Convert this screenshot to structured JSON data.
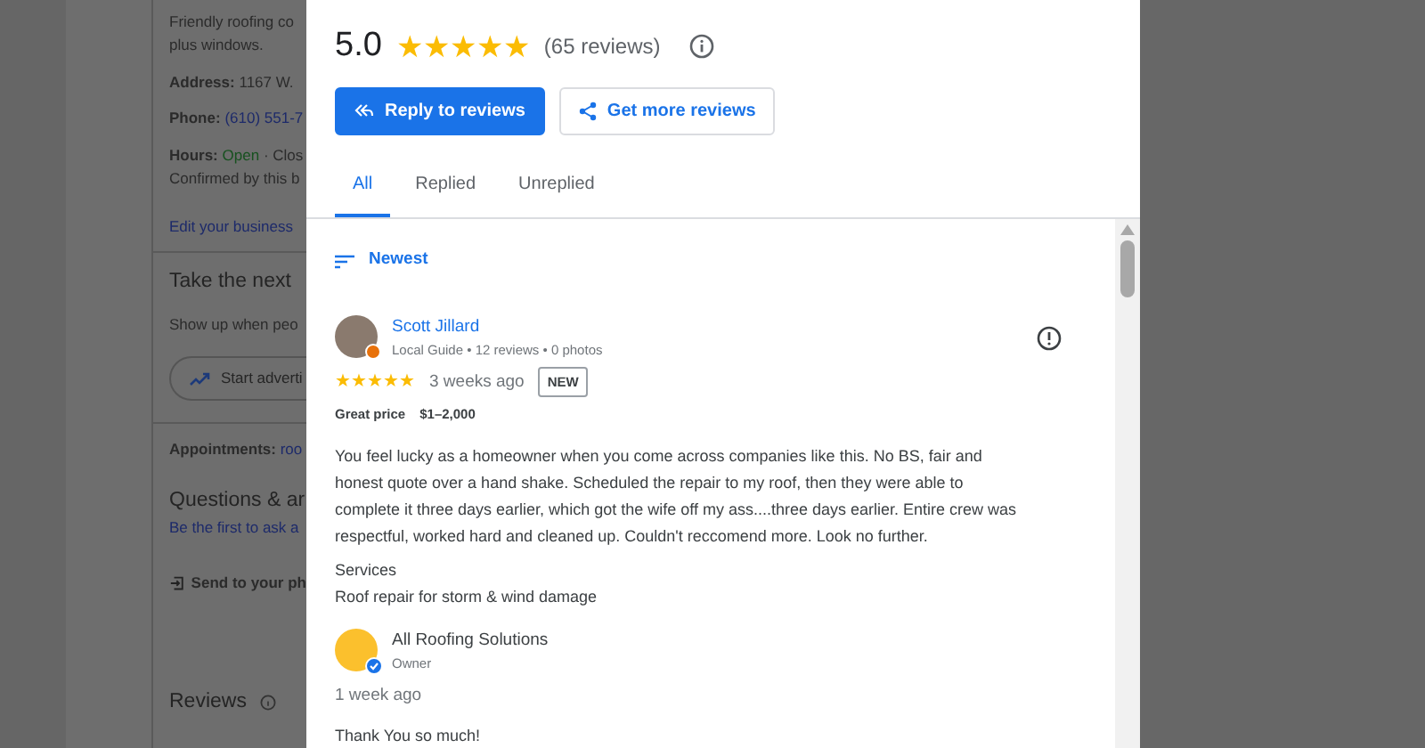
{
  "background_page": {
    "about": [
      {
        "kind": "text",
        "text": "Friendly roofing co"
      },
      {
        "kind": "text",
        "text": "plus windows."
      },
      {
        "kind": "field",
        "label": "Address:",
        "value": "1167 W. "
      },
      {
        "kind": "link-field",
        "label": "Phone:",
        "value": "(610) 551-7"
      },
      {
        "kind": "hours",
        "label": "Hours:",
        "value": "Open",
        "rest": "· Clos"
      },
      {
        "kind": "text",
        "text": "Confirmed by this b"
      },
      {
        "kind": "link",
        "text": "Edit your business"
      }
    ],
    "next_step": {
      "title": "Take the next",
      "text": "Show up when peo",
      "button": "Start adverti"
    },
    "appointments": {
      "label": "Appointments:",
      "value": "roo"
    },
    "questions": {
      "title": "Questions & ar",
      "link": "Be the first to ask a"
    },
    "send": "Send to your ph",
    "reviews_title": "Reviews"
  },
  "dialog": {
    "rating": "5.0",
    "stars": 5,
    "review_count": "(65 reviews)",
    "buttons": [
      {
        "kind": "primary",
        "label": "Reply to reviews"
      },
      {
        "kind": "outline",
        "label": "Get more reviews"
      }
    ],
    "tabs": [
      {
        "label": "All",
        "selected": true
      },
      {
        "label": "Replied",
        "selected": false
      },
      {
        "label": "Unreplied",
        "selected": false
      }
    ],
    "sort": "Newest",
    "reviews": [
      {
        "author": "Scott Jillard",
        "meta": "Local Guide • 12 reviews • 0 photos",
        "stars": 5,
        "time": "3 weeks ago",
        "badge": "NEW",
        "price_label": "Great price",
        "price": "$1–2,000",
        "text": "You feel lucky as a homeowner when you come across companies like this. No BS, fair and honest quote over a hand shake. Scheduled the repair to my roof, then they were able to complete it three days earlier, which got the wife off my ass....three days earlier. Entire crew was respectful, worked hard and cleaned up. Couldn't reccomend more. Look no further.",
        "services_label": "Services",
        "services": "Roof repair for storm & wind damage",
        "reply": {
          "name": "All Roofing Solutions",
          "role": "Owner",
          "time": "1 week ago",
          "text": "Thank You so much!"
        }
      }
    ]
  }
}
